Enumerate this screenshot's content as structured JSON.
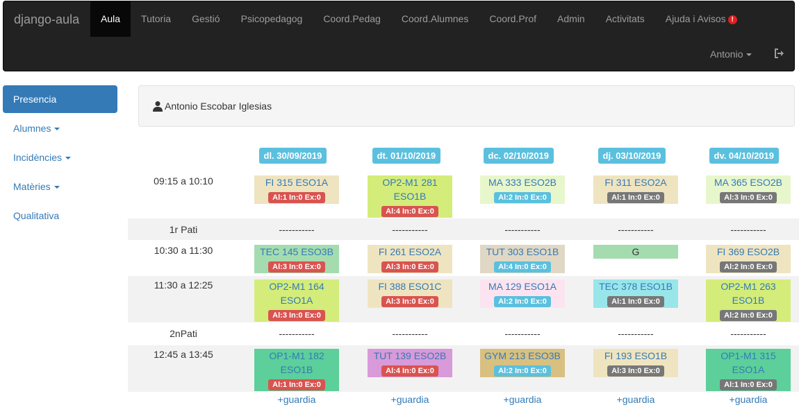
{
  "navbar": {
    "brand": "django-aula",
    "items": [
      "Aula",
      "Tutoria",
      "Gestió",
      "Psicopedagog",
      "Coord.Pedag",
      "Coord.Alumnes",
      "Coord.Prof",
      "Admin",
      "Activitats",
      "Ajuda i Avisos"
    ],
    "active": "Aula",
    "alert_glyph": "!",
    "user": "Antonio",
    "logout_icon": "logout-icon"
  },
  "sidebar": {
    "items": [
      {
        "label": "Presencia",
        "active": true,
        "dropdown": false
      },
      {
        "label": "Alumnes",
        "active": false,
        "dropdown": true
      },
      {
        "label": "Incidències",
        "active": false,
        "dropdown": true
      },
      {
        "label": "Matèries",
        "active": false,
        "dropdown": true
      },
      {
        "label": "Qualitativa",
        "active": false,
        "dropdown": false
      }
    ]
  },
  "user_panel": {
    "name": "Antonio Escobar Iglesias",
    "icon": "user-icon"
  },
  "colors": {
    "navbar_bg": "#222222",
    "link": "#337ab7",
    "header_badge": "#5bc0de",
    "badge_danger": "#d9534f",
    "badge_info": "#5bc0de",
    "badge_default": "#777777"
  },
  "schedule": {
    "days": [
      "dl. 30/09/2019",
      "dt. 01/10/2019",
      "dc. 02/10/2019",
      "dj. 03/10/2019",
      "dv. 04/10/2019"
    ],
    "rows": [
      {
        "time": "09:15 a 10:10",
        "break": false,
        "cells": [
          {
            "l1": "FI 315 ESO1A",
            "l2": "",
            "badge": "Al:1 In:0 Ex:0",
            "badge_type": "danger",
            "color": "#efe4c0"
          },
          {
            "l1": "OP2-M1 281",
            "l2": "ESO1B",
            "badge": "Al:4 In:0 Ex:0",
            "badge_type": "danger",
            "color": "#d4ec7a"
          },
          {
            "l1": "MA 333 ESO2B",
            "l2": "",
            "badge": "Al:2 In:0 Ex:0",
            "badge_type": "info",
            "color": "#e8f6cc"
          },
          {
            "l1": "FI 311 ESO2A",
            "l2": "",
            "badge": "Al:1 In:0 Ex:0",
            "badge_type": "default",
            "color": "#efe4c0"
          },
          {
            "l1": "MA 365 ESO2B",
            "l2": "",
            "badge": "Al:3 In:0 Ex:0",
            "badge_type": "default",
            "color": "#e8f6cc"
          }
        ]
      },
      {
        "time": "1r Pati",
        "break": true,
        "cells": [
          "-----------",
          "-----------",
          "-----------",
          "-----------",
          "-----------"
        ]
      },
      {
        "time": "10:30 a 11:30",
        "break": false,
        "cells": [
          {
            "l1": "TEC 145 ESO3B",
            "l2": "",
            "badge": "Al:3 In:0 Ex:0",
            "badge_type": "danger",
            "color": "#a4dcb0"
          },
          {
            "l1": "FI 261 ESO2A",
            "l2": "",
            "badge": "Al:3 In:0 Ex:0",
            "badge_type": "danger",
            "color": "#efe4c0"
          },
          {
            "l1": "TUT 303 ESO1B",
            "l2": "",
            "badge": "Al:4 In:0 Ex:0",
            "badge_type": "info",
            "color": "#e0d8c4"
          },
          {
            "l1": "G",
            "l2": "",
            "badge": "",
            "badge_type": "",
            "color": "#a4dcb0",
            "plain": true
          },
          {
            "l1": "FI 369 ESO2B",
            "l2": "",
            "badge": "Al:2 In:0 Ex:0",
            "badge_type": "default",
            "color": "#efe4c0"
          }
        ]
      },
      {
        "time": "11:30 a 12:25",
        "break": false,
        "shaded": true,
        "cells": [
          {
            "l1": "OP2-M1 164",
            "l2": "ESO1A",
            "badge": "Al:3 In:0 Ex:0",
            "badge_type": "danger",
            "color": "#d4ec7a"
          },
          {
            "l1": "FI 388 ESO1C",
            "l2": "",
            "badge": "Al:3 In:0 Ex:0",
            "badge_type": "danger",
            "color": "#efe4c0"
          },
          {
            "l1": "MA 129 ESO1A",
            "l2": "",
            "badge": "Al:2 In:0 Ex:0",
            "badge_type": "info",
            "color": "#fbe4f0"
          },
          {
            "l1": "TEC 378 ESO1B",
            "l2": "",
            "badge": "Al:1 In:0 Ex:0",
            "badge_type": "default",
            "color": "#98e6ea"
          },
          {
            "l1": "OP2-M1 263",
            "l2": "ESO1B",
            "badge": "Al:2 In:0 Ex:0",
            "badge_type": "default",
            "color": "#d4ec7a"
          }
        ]
      },
      {
        "time": "2nPati",
        "break": true,
        "cells": [
          "-----------",
          "-----------",
          "-----------",
          "-----------",
          "-----------"
        ]
      },
      {
        "time": "12:45 a 13:45",
        "break": false,
        "shaded": true,
        "cells": [
          {
            "l1": "OP1-M1 182",
            "l2": "ESO1B",
            "badge": "Al:1 In:0 Ex:0",
            "badge_type": "danger",
            "color": "#5ccf9a"
          },
          {
            "l1": "TUT 139 ESO2B",
            "l2": "",
            "badge": "Al:4 In:0 Ex:0",
            "badge_type": "danger",
            "color": "#d89ad8"
          },
          {
            "l1": "GYM 213 ESO3B",
            "l2": "",
            "badge": "Al:2 In:0 Ex:0",
            "badge_type": "info",
            "color": "#d8c080"
          },
          {
            "l1": "FI 193 ESO1B",
            "l2": "",
            "badge": "Al:3 In:0 Ex:0",
            "badge_type": "default",
            "color": "#efe4c0"
          },
          {
            "l1": "OP1-M1 315",
            "l2": "ESO1A",
            "badge": "Al:1 In:0 Ex:0",
            "badge_type": "default",
            "color": "#5ccf9a"
          }
        ]
      }
    ],
    "guardia_label": "+guardia"
  }
}
